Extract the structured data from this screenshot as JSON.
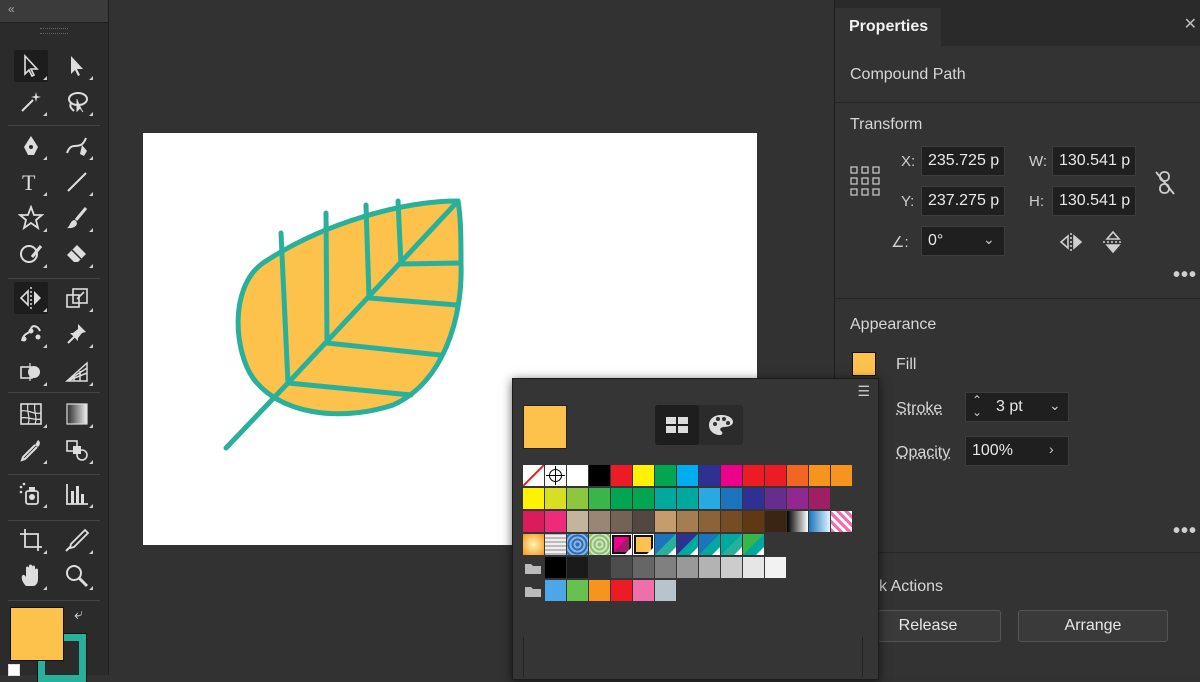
{
  "toolbar": {
    "collapse_glyph": "«",
    "tools": [
      {
        "name": "selection-tool-icon",
        "row": 0,
        "col": 0,
        "selected": true
      },
      {
        "name": "direct-selection-tool-icon",
        "row": 0,
        "col": 1
      },
      {
        "name": "magic-wand-tool-icon",
        "row": 1,
        "col": 0
      },
      {
        "name": "lasso-tool-icon",
        "row": 1,
        "col": 1
      },
      {
        "name": "pen-tool-icon",
        "row": 2,
        "col": 0
      },
      {
        "name": "curvature-tool-icon",
        "row": 2,
        "col": 1
      },
      {
        "name": "type-tool-icon",
        "row": 3,
        "col": 0
      },
      {
        "name": "line-segment-tool-icon",
        "row": 3,
        "col": 1
      },
      {
        "name": "star-tool-icon",
        "row": 4,
        "col": 0
      },
      {
        "name": "paintbrush-tool-icon",
        "row": 4,
        "col": 1
      },
      {
        "name": "shaper-tool-icon",
        "row": 5,
        "col": 0
      },
      {
        "name": "eraser-tool-icon",
        "row": 5,
        "col": 1
      },
      {
        "name": "reflect-tool-icon",
        "row": 6,
        "col": 0,
        "selected": true
      },
      {
        "name": "scale-tool-icon",
        "row": 6,
        "col": 1
      },
      {
        "name": "puppet-warp-tool-icon",
        "row": 7,
        "col": 0
      },
      {
        "name": "pin-tool-icon",
        "row": 7,
        "col": 1
      },
      {
        "name": "shape-builder-tool-icon",
        "row": 8,
        "col": 0
      },
      {
        "name": "perspective-grid-tool-icon",
        "row": 8,
        "col": 1
      },
      {
        "name": "mesh-tool-icon",
        "row": 9,
        "col": 0
      },
      {
        "name": "gradient-tool-icon",
        "row": 9,
        "col": 1
      },
      {
        "name": "eyedropper-tool-icon",
        "row": 10,
        "col": 0
      },
      {
        "name": "blend-tool-icon",
        "row": 10,
        "col": 1
      },
      {
        "name": "symbol-sprayer-tool-icon",
        "row": 11,
        "col": 0
      },
      {
        "name": "column-graph-tool-icon",
        "row": 11,
        "col": 1
      },
      {
        "name": "artboard-tool-icon",
        "row": 12,
        "col": 0
      },
      {
        "name": "slice-tool-icon",
        "row": 12,
        "col": 1
      },
      {
        "name": "hand-tool-icon",
        "row": 13,
        "col": 0
      },
      {
        "name": "zoom-tool-icon",
        "row": 13,
        "col": 1
      }
    ],
    "fill_color": "#fcc24c",
    "stroke_color": "#29b09b"
  },
  "artwork": {
    "fill_color": "#fcc24c",
    "stroke_color": "#29b09b"
  },
  "properties": {
    "tab_label": "Properties",
    "object_type": "Compound Path",
    "transform": {
      "title": "Transform",
      "x_label": "X:",
      "x_value": "235.725 p",
      "y_label": "Y:",
      "y_value": "237.275 p",
      "w_label": "W:",
      "w_value": "130.541 p",
      "h_label": "H:",
      "h_value": "130.541 p",
      "angle_label": "∠:",
      "angle_value": "0°"
    },
    "appearance": {
      "title": "Appearance",
      "fill_label": "Fill",
      "fill_color": "#fcc24c",
      "stroke_label": "Stroke",
      "stroke_value": "3 pt",
      "opacity_label": "Opacity",
      "opacity_value": "100%"
    },
    "quick_actions": {
      "title": "ck Actions",
      "release_label": "Release",
      "arrange_label": "Arrange"
    }
  },
  "swatches": {
    "current_color": "#fcc24c",
    "rows": [
      [
        "none",
        "registration",
        "#ffffff",
        "#000000",
        "#ed1c24",
        "#fff200",
        "#00a651",
        "#00aeef",
        "#2e3192",
        "#ec008c",
        "#ed1c24",
        "#ed1c24",
        "#f26522",
        "#f7941d",
        "#f7941d"
      ],
      [
        "#fff200",
        "#d7df23",
        "#8dc63f",
        "#39b54a",
        "#00a651",
        "#00a651",
        "#00a99d",
        "#00a99d",
        "#27aae1",
        "#1c75bc",
        "#2e3192",
        "#662d91",
        "#92278f",
        "#9e1f63"
      ],
      [
        "#da1c5c",
        "#ee2a7b",
        "#c2b59b",
        "#998675",
        "#736357",
        "#534741",
        "#c69c6d",
        "#a67c52",
        "#8c6239",
        "#754c24",
        "#603913",
        "#3c2415",
        "grad-bw",
        "grad-blue",
        "pattern-pink"
      ],
      [
        "grad-orange",
        "pattern-grid",
        "pattern-blue",
        "pattern-green",
        "grad-sel",
        "#fcc24c-sel",
        "grad-teal1",
        "grad-teal2",
        "grad-teal3",
        "grad-teal4",
        "grad-teal5"
      ],
      [
        "folder",
        "#000000",
        "#1a1a1a",
        "#333333",
        "#4d4d4d",
        "#666666",
        "#808080",
        "#999999",
        "#b3b3b3",
        "#cccccc",
        "#e6e6e6",
        "#f2f2f2"
      ],
      [
        "folder",
        "#4da6e8",
        "#66c150",
        "#f7941d",
        "#ed1c24",
        "#f06eaa",
        "#b8c4cc"
      ]
    ]
  }
}
